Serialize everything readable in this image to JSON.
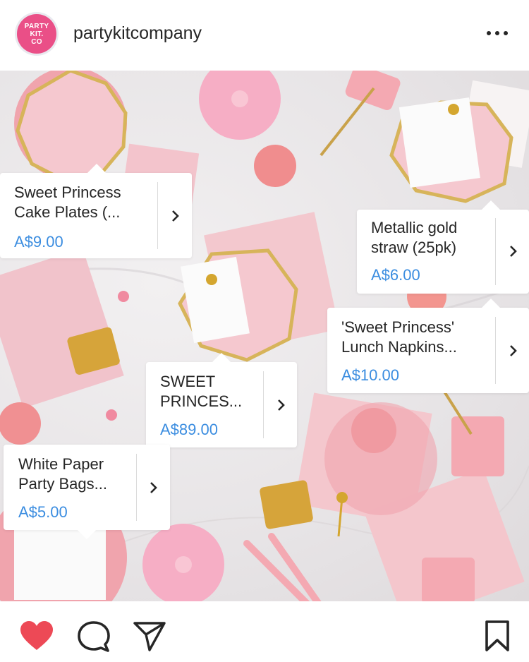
{
  "header": {
    "avatar_lines": [
      "PARTY",
      "KIT.",
      "CO"
    ],
    "username": "partykitcompany",
    "more_icon": "more-horizontal-icon"
  },
  "photo": {
    "alt_icon": "product-photo"
  },
  "tags": [
    {
      "name": "Sweet Princess\nCake Plates (...",
      "price": "A$9.00"
    },
    {
      "name": "Metallic gold\nstraw (25pk)",
      "price": "A$6.00"
    },
    {
      "name": "'Sweet Princess'\nLunch Napkins...",
      "price": "A$10.00"
    },
    {
      "name": "SWEET\nPRINCES...",
      "price": "A$89.00"
    },
    {
      "name": "White Paper\nParty Bags...",
      "price": "A$5.00"
    }
  ],
  "actions": {
    "like_icon": "heart-filled-icon",
    "comment_icon": "comment-icon",
    "share_icon": "send-icon",
    "save_icon": "bookmark-icon"
  },
  "colors": {
    "like": "#ed4956",
    "price": "#3b8de0",
    "brand": "#ea4f87"
  }
}
